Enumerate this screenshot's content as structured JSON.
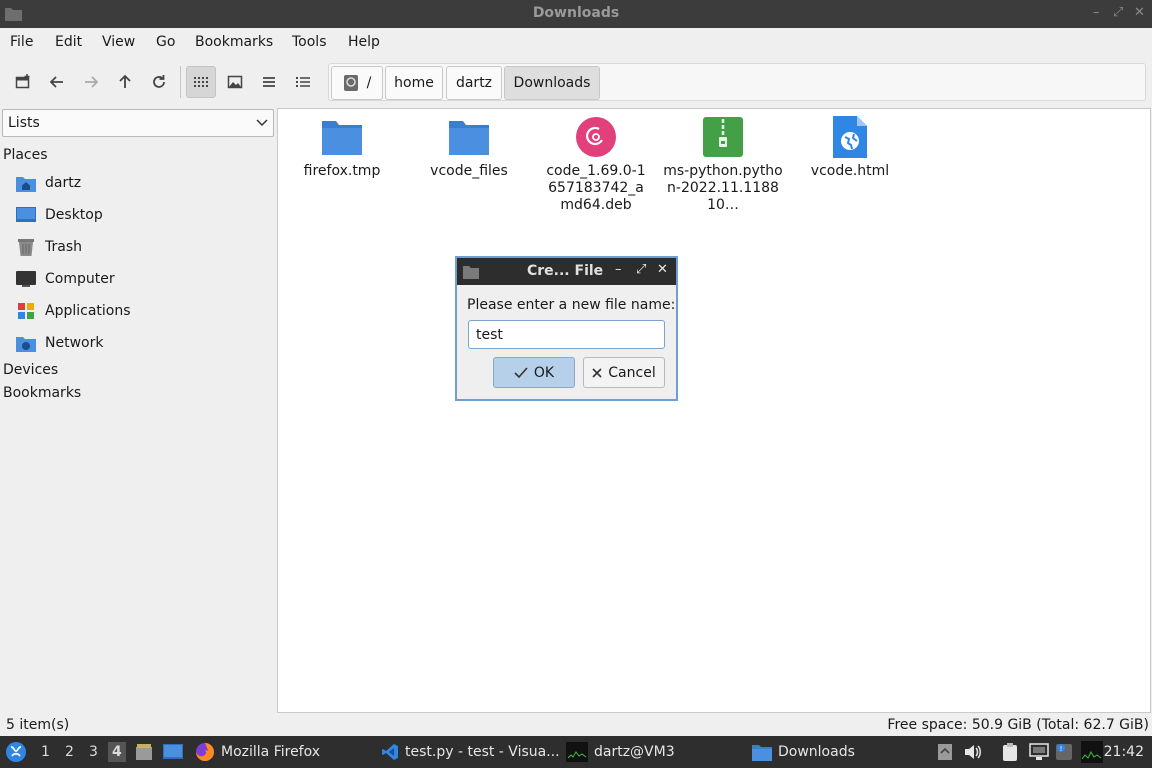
{
  "window": {
    "title": "Downloads"
  },
  "menu": [
    "File",
    "Edit",
    "View",
    "Go",
    "Bookmarks",
    "Tools",
    "Help"
  ],
  "breadcrumbs": {
    "root": "/",
    "items": [
      "home",
      "dartz",
      "Downloads"
    ]
  },
  "sidebar": {
    "mode": "Lists",
    "places_header": "Places",
    "places": [
      "dartz",
      "Desktop",
      "Trash",
      "Computer",
      "Applications",
      "Network"
    ],
    "devices_header": "Devices",
    "bookmarks_header": "Bookmarks"
  },
  "files": [
    {
      "name": "firefox.tmp",
      "type": "folder"
    },
    {
      "name": "vcode_files",
      "type": "folder"
    },
    {
      "name": "code_1.69.0-1657183742_amd64.deb",
      "type": "debian-package"
    },
    {
      "name": "ms-python.python-2022.11.118810…",
      "type": "zip-archive"
    },
    {
      "name": "vcode.html",
      "type": "html-file"
    }
  ],
  "dialog": {
    "title": "Cre... File",
    "prompt": "Please enter a new file name:",
    "input_value": "test",
    "ok_label": "OK",
    "cancel_label": "Cancel"
  },
  "status": {
    "items": "5 item(s)",
    "free_space": "Free space: 50.9 GiB (Total: 62.7 GiB)"
  },
  "taskbar": {
    "workspaces": [
      "1",
      "2",
      "3",
      "4"
    ],
    "active_workspace": "4",
    "tasks": [
      "Mozilla Firefox",
      "test.py - test - Visua...",
      "dartz@VM3",
      "Downloads"
    ],
    "clock": "21:42"
  },
  "colors": {
    "folder": "#4a8fe0",
    "debian": "#e2407a",
    "archive": "#43a047",
    "html": "#2f86e4",
    "dialog_border": "#6f9ed0",
    "ok_button": "#b7d0ea"
  }
}
